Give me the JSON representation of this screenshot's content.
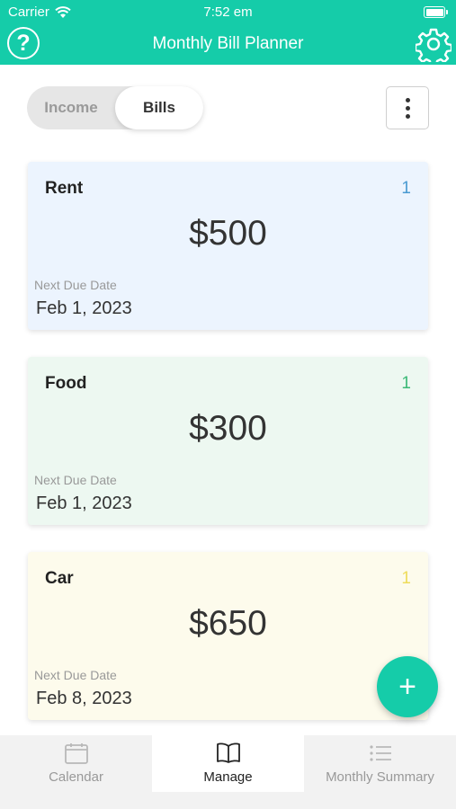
{
  "status_bar": {
    "carrier": "Carrier",
    "time": "7:52 em"
  },
  "header": {
    "title": "Monthly Bill Planner",
    "help_icon": "question-circle-icon",
    "settings_icon": "gear-icon"
  },
  "segment": {
    "income_label": "Income",
    "bills_label": "Bills",
    "selected": "Bills"
  },
  "more_menu_icon": "vertical-ellipsis-icon",
  "cards": [
    {
      "name": "Rent",
      "count": "1",
      "amount": "$500",
      "due_label": "Next Due Date",
      "due_date": "Feb 1, 2023",
      "count_color": "#4a9ad1",
      "background": "#ecf4fe"
    },
    {
      "name": "Food",
      "count": "1",
      "amount": "$300",
      "due_label": "Next Due Date",
      "due_date": "Feb 1, 2023",
      "count_color": "#3cb977",
      "background": "#edf8f1"
    },
    {
      "name": "Car",
      "count": "1",
      "amount": "$650",
      "due_label": "Next Due Date",
      "due_date": "Feb 8, 2023",
      "count_color": "#eedc5a",
      "background": "#fdfbec"
    }
  ],
  "fab": {
    "label": "+",
    "icon": "plus-icon"
  },
  "tabs": [
    {
      "label": "Calendar",
      "icon": "calendar-icon"
    },
    {
      "label": "Manage",
      "icon": "book-icon",
      "active": true
    },
    {
      "label": "Monthly Summary",
      "icon": "list-icon"
    }
  ],
  "colors": {
    "accent": "#15cca9"
  }
}
